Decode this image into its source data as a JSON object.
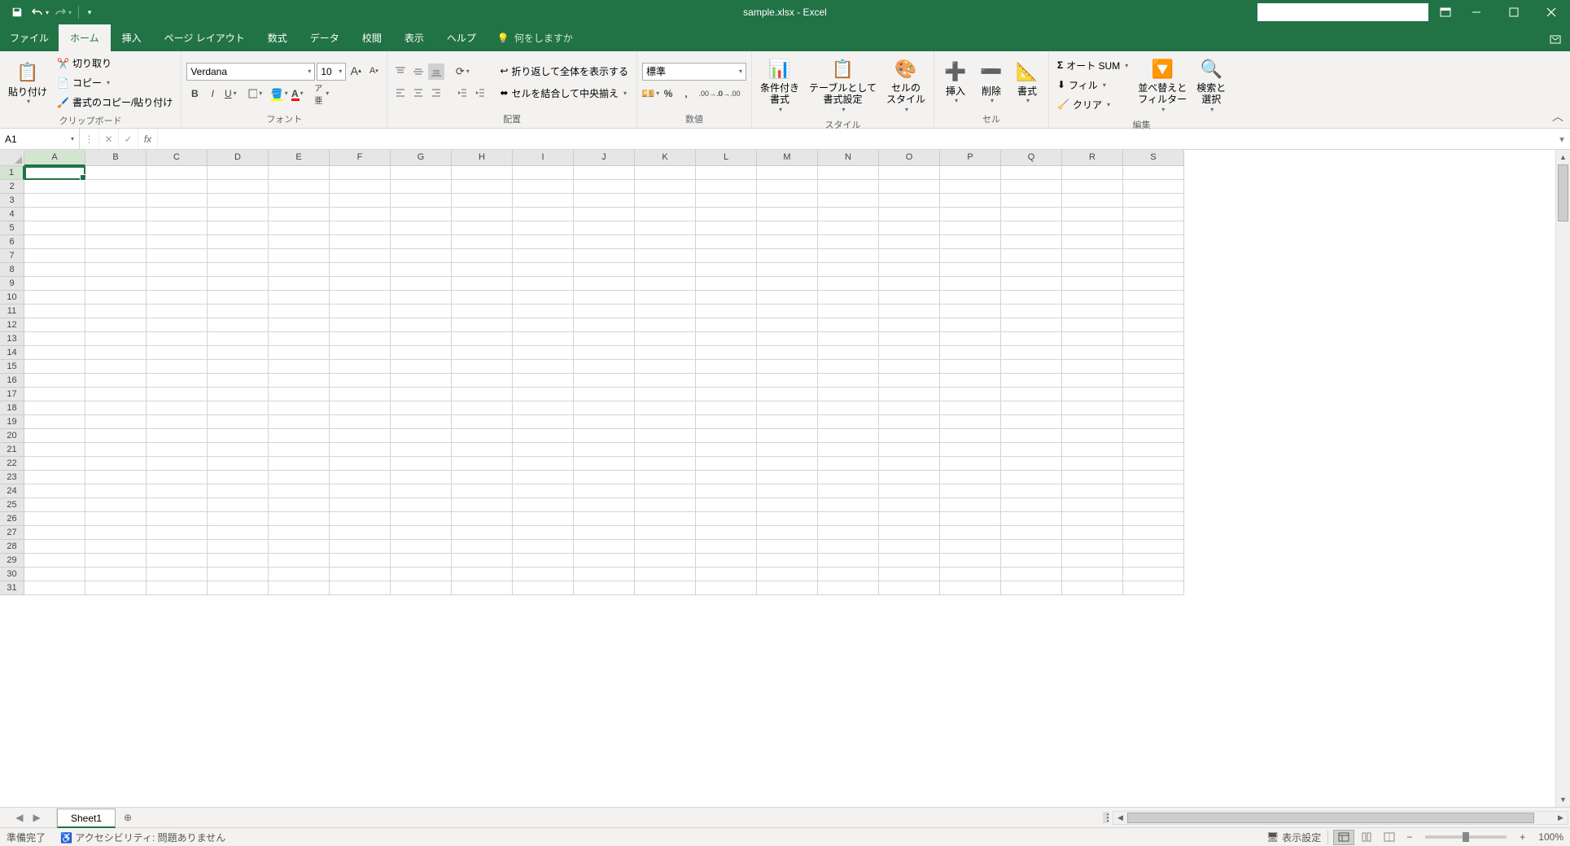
{
  "title": "sample.xlsx  -  Excel",
  "tabs": {
    "file": "ファイル",
    "home": "ホーム",
    "insert": "挿入",
    "pageLayout": "ページ レイアウト",
    "formulas": "数式",
    "data": "データ",
    "review": "校閲",
    "view": "表示",
    "help": "ヘルプ",
    "tellMe": "何をしますか"
  },
  "ribbon": {
    "clipboard": {
      "label": "クリップボード",
      "paste": "貼り付け",
      "cut": "切り取り",
      "copy": "コピー",
      "formatPainter": "書式のコピー/貼り付け"
    },
    "font": {
      "label": "フォント",
      "name": "Verdana",
      "size": "10"
    },
    "alignment": {
      "label": "配置",
      "wrap": "折り返して全体を表示する",
      "merge": "セルを結合して中央揃え"
    },
    "number": {
      "label": "数値",
      "format": "標準"
    },
    "styles": {
      "label": "スタイル",
      "conditional": "条件付き\n書式",
      "tableFormat": "テーブルとして\n書式設定",
      "cellStyles": "セルの\nスタイル"
    },
    "cells": {
      "label": "セル",
      "insert": "挿入",
      "delete": "削除",
      "format": "書式"
    },
    "editing": {
      "label": "編集",
      "autosum": "オート SUM",
      "fill": "フィル",
      "clear": "クリア",
      "sortFilter": "並べ替えと\nフィルター",
      "findSelect": "検索と\n選択"
    }
  },
  "nameBox": "A1",
  "formulaValue": "",
  "columns": [
    "A",
    "B",
    "C",
    "D",
    "E",
    "F",
    "G",
    "H",
    "I",
    "J",
    "K",
    "L",
    "M",
    "N",
    "O",
    "P",
    "Q",
    "R",
    "S"
  ],
  "rows": [
    1,
    2,
    3,
    4,
    5,
    6,
    7,
    8,
    9,
    10,
    11,
    12,
    13,
    14,
    15,
    16,
    17,
    18,
    19,
    20,
    21,
    22,
    23,
    24,
    25,
    26,
    27,
    28,
    29,
    30,
    31
  ],
  "activeCell": {
    "col": 0,
    "row": 0
  },
  "sheetTab": "Sheet1",
  "status": {
    "ready": "準備完了",
    "accessibility": "アクセシビリティ: 問題ありません",
    "displaySettings": "表示設定",
    "zoom": "100%"
  }
}
